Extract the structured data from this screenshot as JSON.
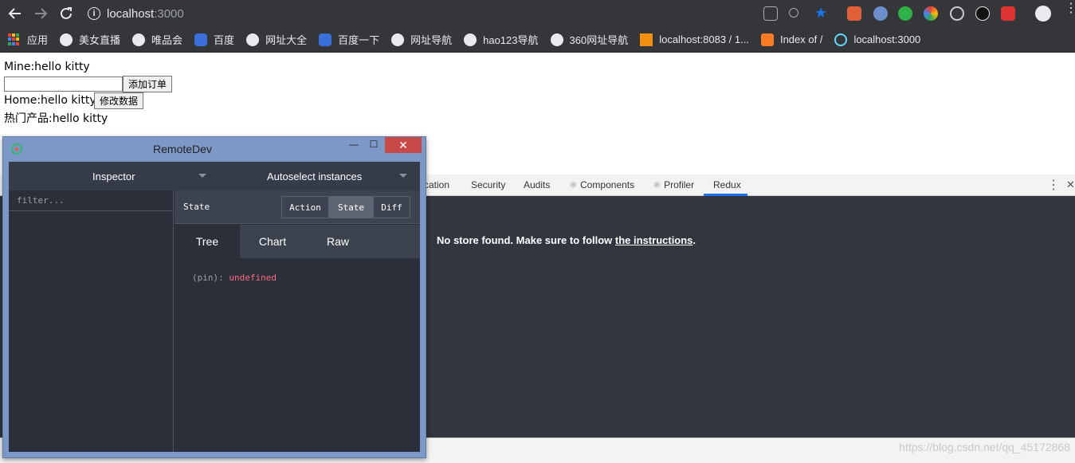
{
  "browser": {
    "url_host": "localhost",
    "url_port": ":3000",
    "info_glyph": "i",
    "bookmarks": [
      {
        "label": "应用",
        "icon": "apps-icon"
      },
      {
        "label": "美女直播",
        "icon": "globe-icon"
      },
      {
        "label": "唯品会",
        "icon": "globe-icon"
      },
      {
        "label": "百度",
        "icon": "baidu-icon"
      },
      {
        "label": "网址大全",
        "icon": "globe-icon"
      },
      {
        "label": "百度一下",
        "icon": "baidu-icon"
      },
      {
        "label": "网址导航",
        "icon": "globe-icon"
      },
      {
        "label": "hao123导航",
        "icon": "globe-icon"
      },
      {
        "label": "360网址导航",
        "icon": "globe-icon"
      },
      {
        "label": "localhost:8083 / 1...",
        "icon": "sailboat-icon"
      },
      {
        "label": "Index of /",
        "icon": "xampp-icon"
      },
      {
        "label": "localhost:3000",
        "icon": "react-icon"
      }
    ]
  },
  "page": {
    "mine_text": "Mine:hello kitty",
    "input_value": "",
    "add_order_button": "添加订单",
    "home_text": "Home:hello kitty",
    "modify_button": "修改数据",
    "hot_products_text": "热门产品:hello kitty"
  },
  "devtools": {
    "tabs": [
      "cation",
      "Security",
      "Audits",
      "Components",
      "Profiler",
      "Redux"
    ],
    "active_tab": "Redux",
    "message_prefix": "No store found. Make sure to follow ",
    "message_link": "the instructions",
    "message_suffix": "."
  },
  "remotedev": {
    "title": "RemoteDev",
    "close_glyph": "✕",
    "min_glyph": "—",
    "max_glyph": "☐",
    "inspector_select": "Inspector",
    "instances_select": "Autoselect instances",
    "filter_placeholder": "filter...",
    "state_label": "State",
    "segments": [
      "Action",
      "State",
      "Diff"
    ],
    "active_segment": "State",
    "view_tabs": [
      "Tree",
      "Chart",
      "Raw"
    ],
    "active_view_tab": "Tree",
    "tree_key": "(pin): ",
    "tree_value": "undefined"
  },
  "watermark": "https://blog.csdn.net/qq_45172868",
  "colors": {
    "chrome_bg": "#35363a",
    "devtools_bg": "#32363f",
    "remotedev_frame": "#7c98c6",
    "remotedev_panel": "#2a2f3a",
    "close_red": "#c74a48",
    "undefined_pink": "#ff6b82",
    "active_tab_blue": "#1a73e8"
  }
}
